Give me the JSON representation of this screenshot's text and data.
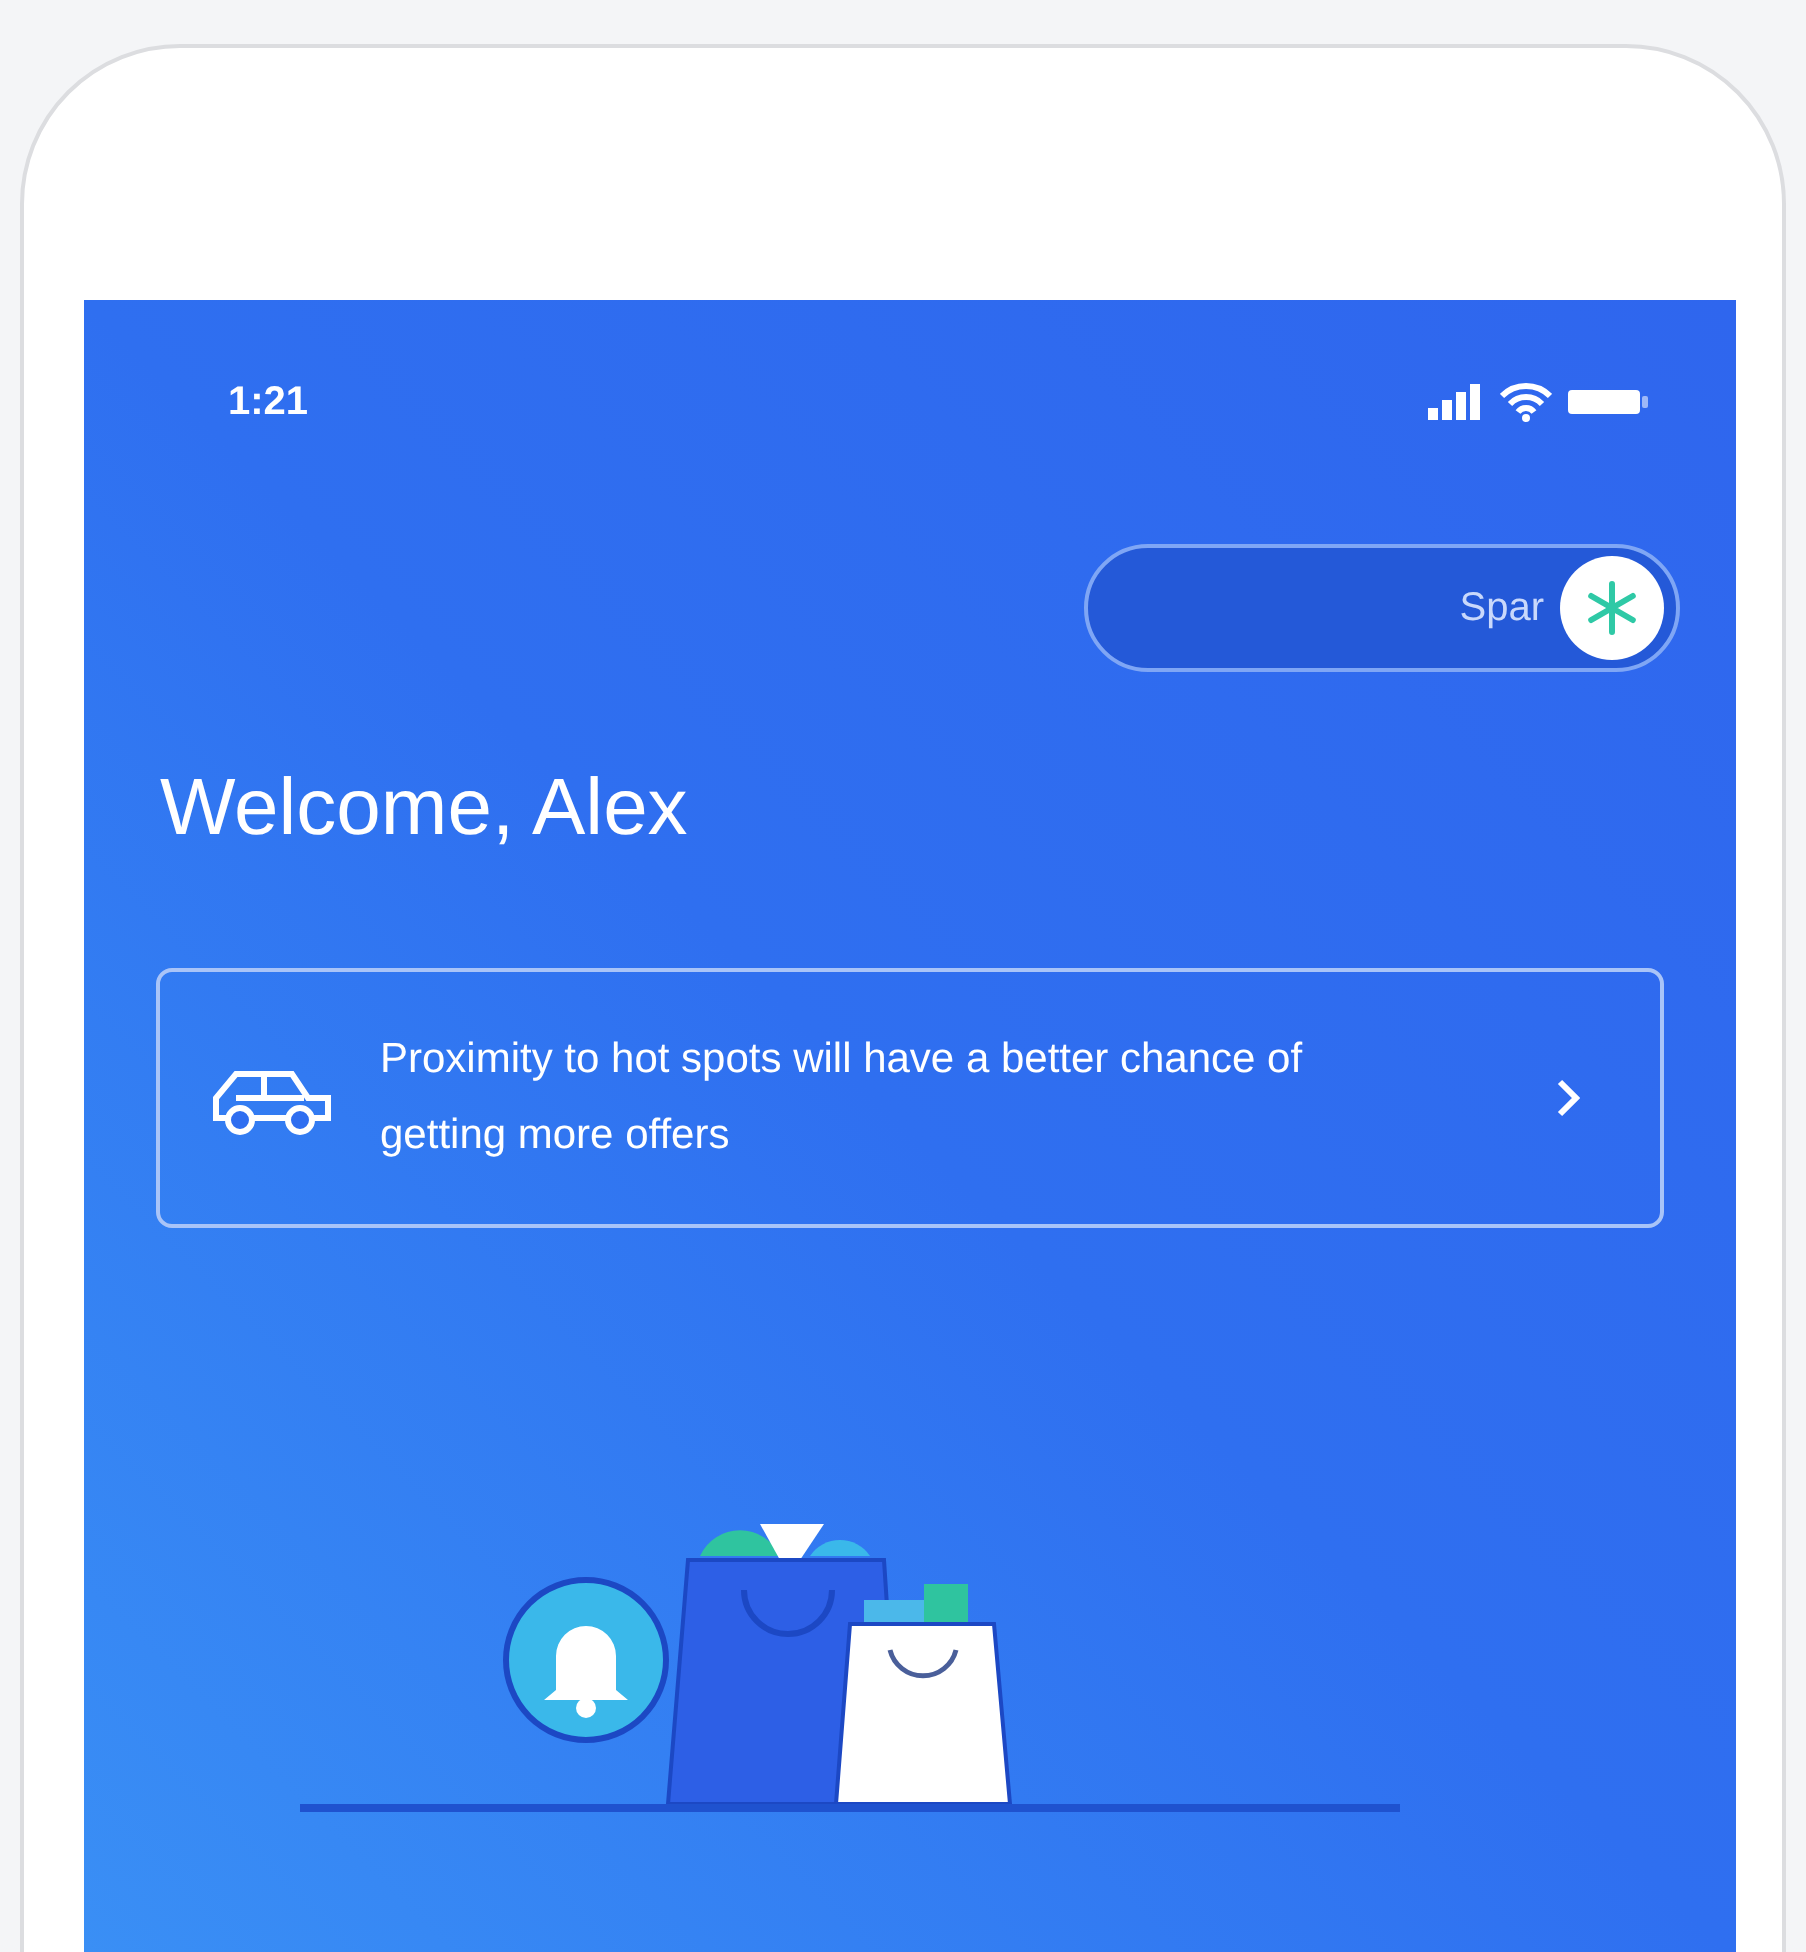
{
  "status_bar": {
    "time": "1:21"
  },
  "toggle": {
    "label": "Spar",
    "on": true
  },
  "greeting": "Welcome, Alex",
  "tip": {
    "text": "Proximity to hot spots will have a better chance of getting more offers"
  }
}
